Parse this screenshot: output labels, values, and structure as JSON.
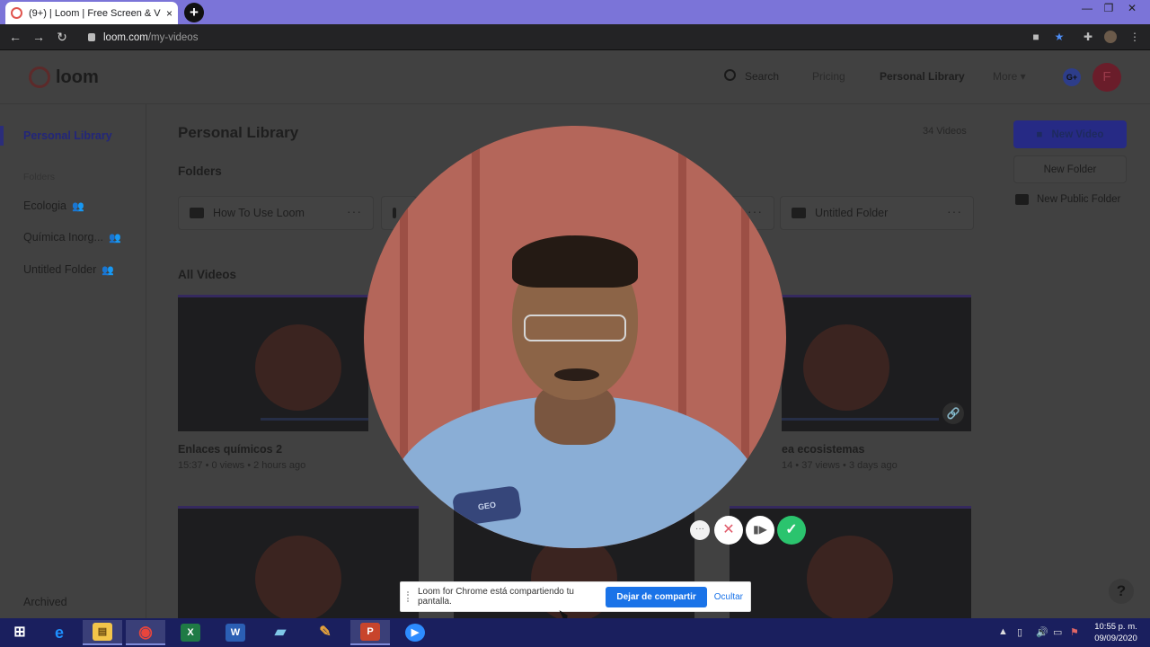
{
  "browser": {
    "tab_title": "(9+) | Loom | Free Screen & V",
    "tab_close": "×",
    "new_tab": "+",
    "url_host": "loom.com",
    "url_path": "/my-videos",
    "back": "←",
    "forward": "→",
    "reload": "↻",
    "window_minimize": "—",
    "window_restore": "❐",
    "window_close": "✕"
  },
  "header": {
    "logo_text": "loom",
    "search": "Search",
    "pricing": "Pricing",
    "personal_library": "Personal Library",
    "more": "More ▾",
    "google_badge": "G+",
    "avatar_letter": "F"
  },
  "sidebar": {
    "active": "Personal Library",
    "folders_label": "Folders",
    "items": [
      {
        "label": "Ecologia"
      },
      {
        "label": "Química Inorg..."
      },
      {
        "label": "Untitled Folder"
      }
    ],
    "archived": "Archived"
  },
  "main": {
    "title": "Personal Library",
    "video_count": "34 Videos",
    "folders_heading": "Folders",
    "folders": [
      {
        "name": "How To Use Loom"
      },
      {
        "name": "Untitled Folder"
      }
    ],
    "all_videos_heading": "All Videos",
    "videos": [
      {
        "title": "Enlaces químicos 2",
        "meta": "15:37 • 0 views • 2 hours ago"
      },
      {
        "title": "ea ecosistemas",
        "meta": "14 • 37 views • 3 days ago"
      }
    ]
  },
  "right_panel": {
    "new_video": "New Video",
    "new_folder": "New Folder",
    "new_public_folder": "New Public Folder"
  },
  "recording": {
    "badge_text": "GEO",
    "more": "···",
    "cancel": "✕",
    "pause": "▮▶",
    "done": "✓"
  },
  "share_bar": {
    "message": "Loom for Chrome está compartiendo tu pantalla.",
    "stop": "Dejar de compartir",
    "hide": "Ocultar"
  },
  "help": "?",
  "taskbar": {
    "time": "10:55 p. m.",
    "date": "09/09/2020",
    "apps": [
      {
        "name": "windows-start",
        "glyph": "⊞",
        "color": "#ffffff"
      },
      {
        "name": "internet-explorer",
        "glyph": "e",
        "color": "#1e90ff"
      },
      {
        "name": "file-explorer",
        "glyph": "▤",
        "color": "#f3c54a"
      },
      {
        "name": "chrome",
        "glyph": "◉",
        "color": "#e8453c"
      },
      {
        "name": "excel",
        "glyph": "X",
        "color": "#1f7a45"
      },
      {
        "name": "word",
        "glyph": "W",
        "color": "#2b5fb4"
      },
      {
        "name": "notes",
        "glyph": "▰",
        "color": "#7fc8e8"
      },
      {
        "name": "paint",
        "glyph": "✎",
        "color": "#e7a33b"
      },
      {
        "name": "powerpoint",
        "glyph": "P",
        "color": "#c8452c"
      },
      {
        "name": "zoom",
        "glyph": "▶",
        "color": "#2d8cff"
      }
    ]
  }
}
